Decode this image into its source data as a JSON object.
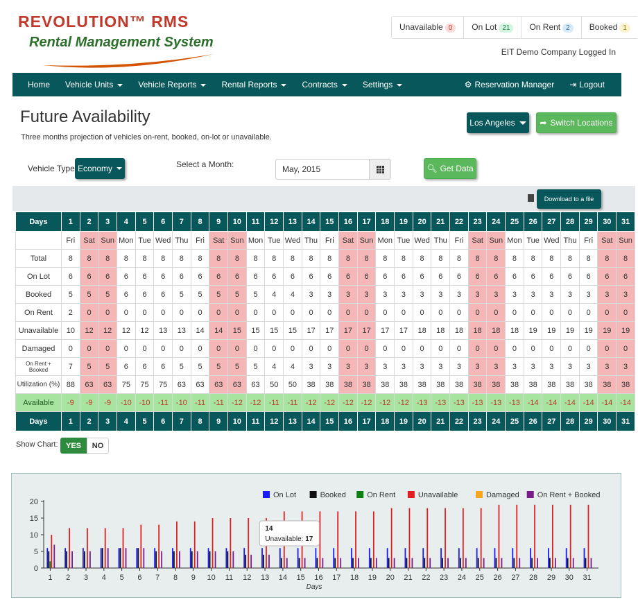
{
  "brand": {
    "name": "REVOLUTION™ RMS",
    "subtitle": "Rental Management System"
  },
  "status": [
    {
      "label": "Unavailable",
      "count": "0",
      "tone": "red"
    },
    {
      "label": "On Lot",
      "count": "21",
      "tone": "green"
    },
    {
      "label": "On Rent",
      "count": "2",
      "tone": "blue"
    },
    {
      "label": "Booked",
      "count": "1",
      "tone": "yellow"
    }
  ],
  "logged_in": "EIT Demo Company Logged In",
  "nav": {
    "home": "Home",
    "vehicle_units": "Vehicle Units",
    "vehicle_reports": "Vehicle Reports",
    "rental_reports": "Rental Reports",
    "contracts": "Contracts",
    "settings": "Settings",
    "reservation_manager": "Reservation Manager",
    "logout": "Logout"
  },
  "page": {
    "title": "Future Availability",
    "subtitle": "Three months projection of vehicles on-rent, booked, on-lot or unavailable.",
    "location_button": "Los Angeles",
    "switch_button": "Switch Locations",
    "vehicle_type_label": "Vehicle Type:",
    "vehicle_type_value": "Economy",
    "month_label": "Select a Month:",
    "month_value": "May, 2015",
    "get_data": "Get Data",
    "download": "Download to a file"
  },
  "table": {
    "days_label": "Days",
    "days": [
      "1",
      "2",
      "3",
      "4",
      "5",
      "6",
      "7",
      "8",
      "9",
      "10",
      "11",
      "12",
      "13",
      "14",
      "15",
      "16",
      "17",
      "18",
      "19",
      "20",
      "21",
      "22",
      "23",
      "24",
      "25",
      "26",
      "27",
      "28",
      "29",
      "30",
      "31"
    ],
    "weekdays": [
      "Fri",
      "Sat",
      "Sun",
      "Mon",
      "Tue",
      "Wed",
      "Thu",
      "Fri",
      "Sat",
      "Sun",
      "Mon",
      "Tue",
      "Wed",
      "Thu",
      "Fri",
      "Sat",
      "Sun",
      "Mon",
      "Tue",
      "Wed",
      "Thu",
      "Fri",
      "Sat",
      "Sun",
      "Mon",
      "Tue",
      "Wed",
      "Thu",
      "Fri",
      "Sat",
      "Sun"
    ],
    "rows": [
      {
        "label": "Total",
        "values": [
          "8",
          "8",
          "8",
          "8",
          "8",
          "8",
          "8",
          "8",
          "8",
          "8",
          "8",
          "8",
          "8",
          "8",
          "8",
          "8",
          "8",
          "8",
          "8",
          "8",
          "8",
          "8",
          "8",
          "8",
          "8",
          "8",
          "8",
          "8",
          "8",
          "8",
          "8"
        ]
      },
      {
        "label": "On Lot",
        "values": [
          "6",
          "6",
          "6",
          "6",
          "6",
          "6",
          "6",
          "6",
          "6",
          "6",
          "6",
          "6",
          "6",
          "6",
          "6",
          "6",
          "6",
          "6",
          "6",
          "6",
          "6",
          "6",
          "6",
          "6",
          "6",
          "6",
          "6",
          "6",
          "6",
          "6",
          "6"
        ]
      },
      {
        "label": "Booked",
        "values": [
          "5",
          "5",
          "5",
          "6",
          "6",
          "6",
          "5",
          "5",
          "5",
          "5",
          "5",
          "4",
          "4",
          "3",
          "3",
          "3",
          "3",
          "3",
          "3",
          "3",
          "3",
          "3",
          "3",
          "3",
          "3",
          "3",
          "3",
          "3",
          "3",
          "3",
          "3"
        ]
      },
      {
        "label": "On Rent",
        "values": [
          "2",
          "0",
          "0",
          "0",
          "0",
          "0",
          "0",
          "0",
          "0",
          "0",
          "0",
          "0",
          "0",
          "0",
          "0",
          "0",
          "0",
          "0",
          "0",
          "0",
          "0",
          "0",
          "0",
          "0",
          "0",
          "0",
          "0",
          "0",
          "0",
          "0",
          "0"
        ]
      },
      {
        "label": "Unavailable",
        "values": [
          "10",
          "12",
          "12",
          "12",
          "12",
          "13",
          "13",
          "14",
          "14",
          "15",
          "15",
          "15",
          "15",
          "17",
          "17",
          "17",
          "17",
          "17",
          "17",
          "18",
          "18",
          "18",
          "18",
          "18",
          "18",
          "19",
          "19",
          "19",
          "19",
          "19",
          "19"
        ]
      },
      {
        "label": "Damaged",
        "values": [
          "0",
          "0",
          "0",
          "0",
          "0",
          "0",
          "0",
          "0",
          "0",
          "0",
          "0",
          "0",
          "0",
          "0",
          "0",
          "0",
          "0",
          "0",
          "0",
          "0",
          "0",
          "0",
          "0",
          "0",
          "0",
          "0",
          "0",
          "0",
          "0",
          "0",
          "0"
        ]
      },
      {
        "label": "On Rent + Booked",
        "values": [
          "7",
          "5",
          "5",
          "6",
          "6",
          "6",
          "5",
          "5",
          "5",
          "5",
          "5",
          "4",
          "4",
          "3",
          "3",
          "3",
          "3",
          "3",
          "3",
          "3",
          "3",
          "3",
          "3",
          "3",
          "3",
          "3",
          "3",
          "3",
          "3",
          "3",
          "3"
        ]
      },
      {
        "label": "Utilization (%)",
        "values": [
          "88",
          "63",
          "63",
          "75",
          "75",
          "75",
          "63",
          "63",
          "63",
          "63",
          "63",
          "50",
          "50",
          "38",
          "38",
          "38",
          "38",
          "38",
          "38",
          "38",
          "38",
          "38",
          "38",
          "38",
          "38",
          "38",
          "38",
          "38",
          "38",
          "38",
          "38"
        ]
      }
    ],
    "available_label": "Available",
    "available": [
      "-9",
      "-9",
      "-9",
      "-10",
      "-10",
      "-11",
      "-10",
      "-11",
      "-11",
      "-12",
      "-12",
      "-11",
      "-11",
      "-12",
      "-12",
      "-12",
      "-12",
      "-12",
      "-12",
      "-13",
      "-13",
      "-13",
      "-13",
      "-13",
      "-13",
      "-14",
      "-14",
      "-14",
      "-14",
      "-14",
      "-14"
    ]
  },
  "show_chart": {
    "label": "Show Chart:",
    "yes": "YES",
    "no": "NO"
  },
  "colors": {
    "teal": "#07575b",
    "weekend": "#f4b6b6",
    "available": "#a7e4a0",
    "green_btn": "#5cb85c"
  },
  "chart_data": {
    "type": "bar",
    "xlabel": "Days",
    "ylabel": "",
    "ylim": [
      0,
      20
    ],
    "yticks": [
      0,
      5,
      10,
      15,
      20
    ],
    "legend_position": "top-right",
    "categories": [
      "1",
      "2",
      "3",
      "4",
      "5",
      "6",
      "7",
      "8",
      "9",
      "10",
      "11",
      "12",
      "13",
      "14",
      "15",
      "16",
      "17",
      "18",
      "19",
      "20",
      "21",
      "22",
      "23",
      "24",
      "25",
      "26",
      "27",
      "28",
      "29",
      "30",
      "31"
    ],
    "series": [
      {
        "name": "On Lot",
        "color": "#1a1aff",
        "values": [
          6,
          6,
          6,
          6,
          6,
          6,
          6,
          6,
          6,
          6,
          6,
          6,
          6,
          6,
          6,
          6,
          6,
          6,
          6,
          6,
          6,
          6,
          6,
          6,
          6,
          6,
          6,
          6,
          6,
          6,
          6
        ]
      },
      {
        "name": "Booked",
        "color": "#111111",
        "values": [
          5,
          5,
          5,
          6,
          6,
          6,
          5,
          5,
          5,
          5,
          5,
          4,
          4,
          3,
          3,
          3,
          3,
          3,
          3,
          3,
          3,
          3,
          3,
          3,
          3,
          3,
          3,
          3,
          3,
          3,
          3
        ]
      },
      {
        "name": "On Rent",
        "color": "#0f7f0f",
        "values": [
          2,
          0,
          0,
          0,
          0,
          0,
          0,
          0,
          0,
          0,
          0,
          0,
          0,
          0,
          0,
          0,
          0,
          0,
          0,
          0,
          0,
          0,
          0,
          0,
          0,
          0,
          0,
          0,
          0,
          0,
          0
        ]
      },
      {
        "name": "Unavailable",
        "color": "#e02020",
        "values": [
          10,
          12,
          12,
          12,
          12,
          13,
          13,
          14,
          14,
          15,
          15,
          15,
          15,
          17,
          17,
          17,
          17,
          17,
          17,
          18,
          18,
          18,
          18,
          18,
          18,
          19,
          19,
          19,
          19,
          19,
          19
        ]
      },
      {
        "name": "Damaged",
        "color": "#f5a623",
        "values": [
          0,
          0,
          0,
          0,
          0,
          0,
          0,
          0,
          0,
          0,
          0,
          0,
          0,
          0,
          0,
          0,
          0,
          0,
          0,
          0,
          0,
          0,
          0,
          0,
          0,
          0,
          0,
          0,
          0,
          0,
          0
        ]
      },
      {
        "name": "On Rent + Booked",
        "color": "#7b1a8c",
        "values": [
          7,
          5,
          5,
          6,
          6,
          6,
          5,
          5,
          5,
          5,
          5,
          4,
          4,
          3,
          3,
          3,
          3,
          3,
          3,
          3,
          3,
          3,
          3,
          3,
          3,
          3,
          3,
          3,
          3,
          3,
          3
        ]
      }
    ],
    "tooltip": {
      "title": "14",
      "label": "Unavailable:",
      "value": "17"
    }
  }
}
